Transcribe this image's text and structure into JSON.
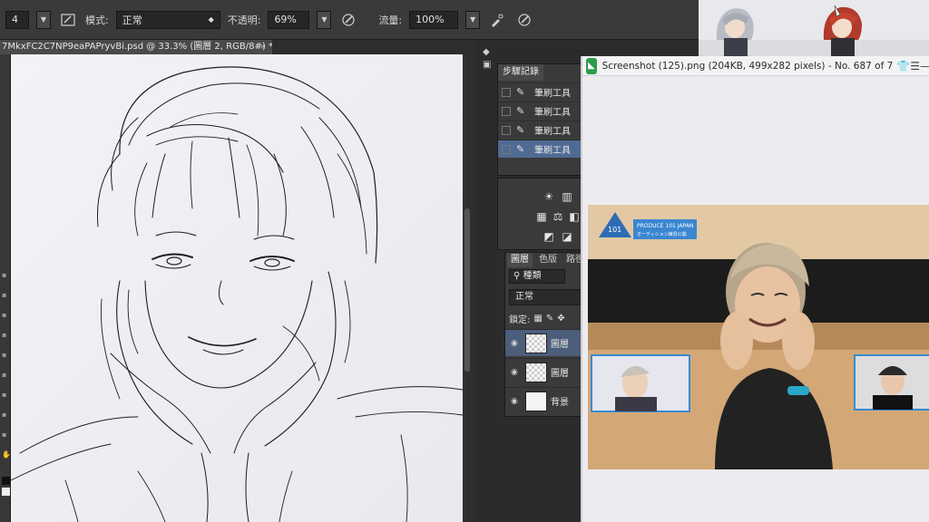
{
  "options_bar": {
    "brush_size": "4",
    "mode_label": "模式:",
    "mode_value": "正常",
    "opacity_label": "不透明:",
    "opacity_value": "69%",
    "flow_label": "流量:",
    "flow_value": "100%"
  },
  "document": {
    "tab_title": "7MkxFC2C7NP9eaPAPryvBi.psd @ 33.3% (圖層 2, RGB/8#) *",
    "close_glyph": "×"
  },
  "history_panel": {
    "tab_label": "步驟記錄",
    "items": [
      {
        "label": "筆刷工具"
      },
      {
        "label": "筆刷工具"
      },
      {
        "label": "筆刷工具"
      },
      {
        "label": "筆刷工具"
      }
    ]
  },
  "layers_panel": {
    "tabs": [
      "圖層",
      "色版",
      "路徑"
    ],
    "kind_value": "種類",
    "blend_value": "正常",
    "lock_label": "鎖定:",
    "layers": [
      {
        "name": "圖層"
      },
      {
        "name": "圖層"
      },
      {
        "name": "背景"
      }
    ]
  },
  "viewer": {
    "title": "Screenshot (125).png (204KB, 499x282 pixels) - No. 687 of 7",
    "photo_badge_text": "PRODUCE 101 JAPAN",
    "photo_badge_sub": "オーディション練習公開",
    "photo_badge_num": "101"
  },
  "colors": {
    "ps_dark": "#2b2b2b",
    "ps_panel": "#3a3a3a",
    "history_active": "#4f6b94",
    "viewer_icon": "#2a9d4a",
    "canvas_bg": "#f0eff3"
  },
  "icons": [
    "brush-icon",
    "airbrush-icon",
    "pressure-icon",
    "eye-icon",
    "lock-icon",
    "minimize-icon",
    "menu-icon"
  ]
}
